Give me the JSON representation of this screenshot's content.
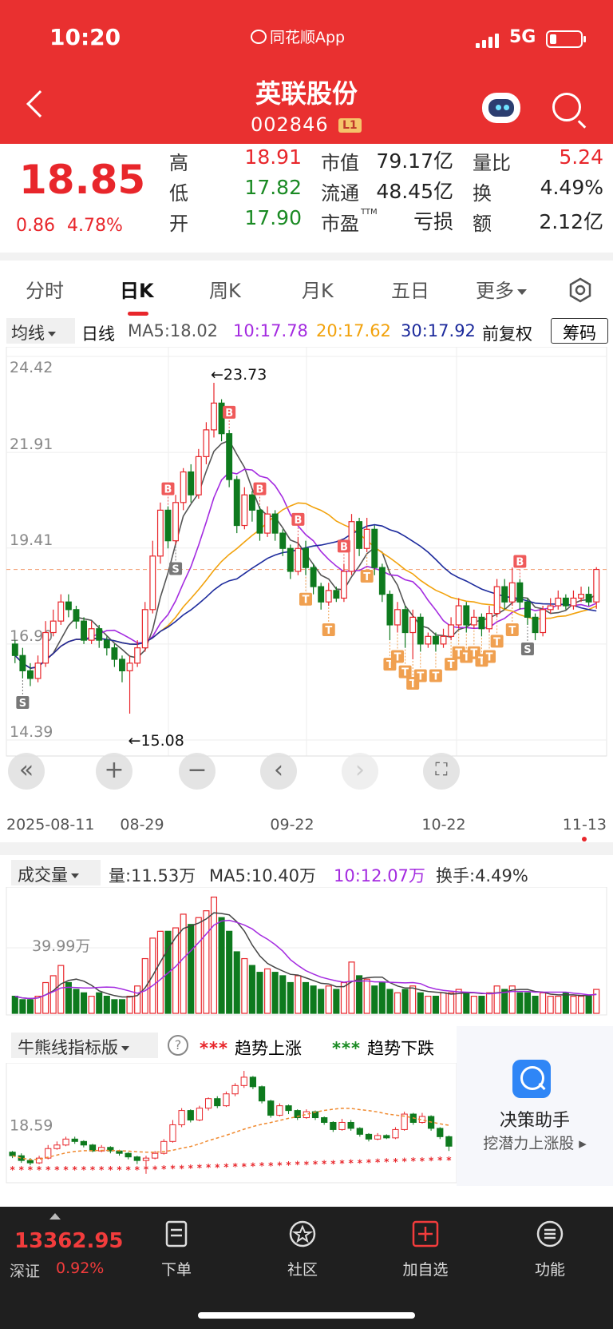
{
  "status": {
    "time": "10:20",
    "app": "同花顺App",
    "network": "5G"
  },
  "header": {
    "name": "英联股份",
    "code": "002846",
    "level": "L1"
  },
  "quote": {
    "price": "18.85",
    "change": "0.86",
    "change_pct": "4.78%",
    "high_label": "高",
    "high": "18.91",
    "low_label": "低",
    "low": "17.82",
    "open_label": "开",
    "open": "17.90",
    "mcap_label": "市值",
    "mcap": "79.17亿",
    "float_label": "流通",
    "float": "48.45亿",
    "pe_label": "市盈",
    "pe_sup": "TTM",
    "pe": "亏损",
    "vr_label": "量比",
    "vr": "5.24",
    "turn_label": "换",
    "turn": "4.49%",
    "amt_label": "额",
    "amt": "2.12亿"
  },
  "tabs": [
    {
      "label": "分时"
    },
    {
      "label": "日K"
    },
    {
      "label": "周K"
    },
    {
      "label": "月K"
    },
    {
      "label": "五日"
    },
    {
      "label": "更多"
    }
  ],
  "ma_bar": {
    "selector": "均线",
    "period": "日线",
    "ma5": "MA5:18.02",
    "ma10": "10:17.78",
    "ma20": "20:17.62",
    "ma30": "30:17.92",
    "adjust": "前复权",
    "chip": "筹码"
  },
  "colors": {
    "up": "#e8262b",
    "down": "#0e7a1e",
    "ma5": "#555555",
    "ma10": "#a42be0",
    "ma20": "#f2a20c",
    "ma30": "#1c2a9c",
    "signal": "#f0a050"
  },
  "chart_data": {
    "type": "candlestick",
    "y_ticks": [
      "24.42",
      "21.91",
      "19.41",
      "16.90",
      "14.39"
    ],
    "ylim": [
      14.39,
      24.42
    ],
    "x_ticks": [
      "2025-08-11",
      "08-29",
      "09-22",
      "10-22",
      "11-13"
    ],
    "high_annotation": "←23.73",
    "low_annotation": "←15.08",
    "last_close": 18.85,
    "candles": [
      [
        16.9,
        16.6,
        17.0,
        16.4
      ],
      [
        16.6,
        16.2,
        16.8,
        16.0
      ],
      [
        16.2,
        16.0,
        16.4,
        15.8
      ],
      [
        16.0,
        16.4,
        16.6,
        15.9
      ],
      [
        16.4,
        17.2,
        17.5,
        16.3
      ],
      [
        17.2,
        17.5,
        17.8,
        17.1
      ],
      [
        17.5,
        18.0,
        18.2,
        17.4
      ],
      [
        18.0,
        17.8,
        18.2,
        17.6
      ],
      [
        17.8,
        17.5,
        17.9,
        17.3
      ],
      [
        17.5,
        17.0,
        17.6,
        16.9
      ],
      [
        17.0,
        17.3,
        17.5,
        16.9
      ],
      [
        17.3,
        17.0,
        17.4,
        16.8
      ],
      [
        17.0,
        16.8,
        17.1,
        16.6
      ],
      [
        16.8,
        16.5,
        16.9,
        16.3
      ],
      [
        16.5,
        16.2,
        16.6,
        15.9
      ],
      [
        16.2,
        16.4,
        16.6,
        15.08
      ],
      [
        16.4,
        16.8,
        17.0,
        16.3
      ],
      [
        16.8,
        17.8,
        18.0,
        16.7
      ],
      [
        17.8,
        19.2,
        19.6,
        17.7
      ],
      [
        19.2,
        20.4,
        20.6,
        19.0
      ],
      [
        20.4,
        19.6,
        20.5,
        19.4
      ],
      [
        19.6,
        20.6,
        20.8,
        19.5
      ],
      [
        20.6,
        21.4,
        21.5,
        20.4
      ],
      [
        21.4,
        20.8,
        21.6,
        20.6
      ],
      [
        20.8,
        21.8,
        22.0,
        20.7
      ],
      [
        21.8,
        22.5,
        22.7,
        21.6
      ],
      [
        22.5,
        23.2,
        23.73,
        22.3
      ],
      [
        23.2,
        22.4,
        23.3,
        22.2
      ],
      [
        22.4,
        21.2,
        22.5,
        21.0
      ],
      [
        21.2,
        20.0,
        21.3,
        19.8
      ],
      [
        20.0,
        20.8,
        21.0,
        19.9
      ],
      [
        20.8,
        20.4,
        20.9,
        20.1
      ],
      [
        20.4,
        19.8,
        20.5,
        19.6
      ],
      [
        19.8,
        20.3,
        20.5,
        19.7
      ],
      [
        20.3,
        19.8,
        20.4,
        19.6
      ],
      [
        19.8,
        19.4,
        19.9,
        19.2
      ],
      [
        19.4,
        18.8,
        19.5,
        18.6
      ],
      [
        18.8,
        19.4,
        19.7,
        18.7
      ],
      [
        19.4,
        18.9,
        19.6,
        18.7
      ],
      [
        18.9,
        18.4,
        19.0,
        18.2
      ],
      [
        18.4,
        18.0,
        18.5,
        17.8
      ],
      [
        18.0,
        18.3,
        18.5,
        17.9
      ],
      [
        18.3,
        18.1,
        18.4,
        18.0
      ],
      [
        18.1,
        18.8,
        19.0,
        18.0
      ],
      [
        18.8,
        20.1,
        20.3,
        18.7
      ],
      [
        20.1,
        19.4,
        20.2,
        19.2
      ],
      [
        19.4,
        19.9,
        20.2,
        19.3
      ],
      [
        19.9,
        18.9,
        20.0,
        18.7
      ],
      [
        18.9,
        18.2,
        19.0,
        18.0
      ],
      [
        18.2,
        17.4,
        18.3,
        17.0
      ],
      [
        17.4,
        17.8,
        18.0,
        17.2
      ],
      [
        17.8,
        17.2,
        17.9,
        16.8
      ],
      [
        17.2,
        17.6,
        17.8,
        16.5
      ],
      [
        17.6,
        16.9,
        17.7,
        16.7
      ],
      [
        16.9,
        17.1,
        17.2,
        16.8
      ],
      [
        17.1,
        16.9,
        17.2,
        16.7
      ],
      [
        16.9,
        17.1,
        17.3,
        16.8
      ],
      [
        17.1,
        17.4,
        17.6,
        17.0
      ],
      [
        17.4,
        17.9,
        18.1,
        17.3
      ],
      [
        17.9,
        17.4,
        18.0,
        17.2
      ],
      [
        17.4,
        17.6,
        17.8,
        17.3
      ],
      [
        17.6,
        17.3,
        17.7,
        17.1
      ],
      [
        17.3,
        17.7,
        17.9,
        17.2
      ],
      [
        17.7,
        18.4,
        18.6,
        17.6
      ],
      [
        18.4,
        18.0,
        18.6,
        17.8
      ],
      [
        18.0,
        18.5,
        18.9,
        17.9
      ],
      [
        18.5,
        18.0,
        18.6,
        17.8
      ],
      [
        18.0,
        17.6,
        18.1,
        17.4
      ],
      [
        17.6,
        17.2,
        17.7,
        17.0
      ],
      [
        17.2,
        17.8,
        17.9,
        17.1
      ],
      [
        17.8,
        17.9,
        18.1,
        17.7
      ],
      [
        17.9,
        18.1,
        18.3,
        17.8
      ],
      [
        18.1,
        17.9,
        18.2,
        17.8
      ],
      [
        17.9,
        18.1,
        18.3,
        17.8
      ],
      [
        18.1,
        18.2,
        18.4,
        18.0
      ],
      [
        18.2,
        18.0,
        18.4,
        17.9
      ],
      [
        18.0,
        18.85,
        18.91,
        17.82
      ]
    ],
    "ma_series": [
      "MA5",
      "MA10",
      "MA20",
      "MA30"
    ],
    "signals": [
      {
        "index": 1,
        "label": "S"
      },
      {
        "index": 20,
        "label": "B"
      },
      {
        "index": 21,
        "label": "S"
      },
      {
        "index": 28,
        "label": "B"
      },
      {
        "index": 32,
        "label": "B"
      },
      {
        "index": 37,
        "label": "B"
      },
      {
        "index": 38,
        "label": "T"
      },
      {
        "index": 41,
        "label": "T"
      },
      {
        "index": 43,
        "label": "B"
      },
      {
        "index": 46,
        "label": "T"
      },
      {
        "index": 49,
        "label": "T"
      },
      {
        "index": 50,
        "label": "T"
      },
      {
        "index": 51,
        "label": "T"
      },
      {
        "index": 52,
        "label": "T"
      },
      {
        "index": 53,
        "label": "T"
      },
      {
        "index": 55,
        "label": "T"
      },
      {
        "index": 57,
        "label": "T"
      },
      {
        "index": 58,
        "label": "T"
      },
      {
        "index": 59,
        "label": "T"
      },
      {
        "index": 60,
        "label": "T"
      },
      {
        "index": 61,
        "label": "T"
      },
      {
        "index": 62,
        "label": "T"
      },
      {
        "index": 63,
        "label": "T"
      },
      {
        "index": 65,
        "label": "T"
      },
      {
        "index": 66,
        "label": "B"
      },
      {
        "index": 67,
        "label": "S"
      }
    ]
  },
  "volume": {
    "selector": "成交量",
    "vol": "量:11.53万",
    "ma5": "MA5:10.40万",
    "ma10": "10:12.07万",
    "turnover": "换手:4.49%",
    "y_tick": "39.99万",
    "values": [
      5,
      4,
      4,
      5,
      9,
      11,
      14,
      9,
      7,
      6,
      5,
      6,
      5,
      4,
      4,
      5,
      8,
      16,
      22,
      24,
      24,
      25,
      29,
      26,
      28,
      30,
      34,
      28,
      24,
      18,
      16,
      14,
      12,
      13,
      12,
      11,
      9,
      11,
      9,
      8,
      7,
      8,
      7,
      9,
      15,
      11,
      10,
      8,
      9,
      7,
      6,
      7,
      8,
      6,
      5,
      5,
      6,
      6,
      7,
      6,
      5,
      5,
      6,
      8,
      7,
      8,
      6,
      6,
      5,
      6,
      5,
      5,
      6,
      5,
      5,
      5,
      7
    ]
  },
  "bull": {
    "selector": "牛熊线指标版",
    "help": "?",
    "legend_up": "趋势上涨",
    "legend_down": "趋势下跌",
    "y_tick": "18.59"
  },
  "helper": {
    "title": "决策助手",
    "subtitle": "挖潜力上涨股"
  },
  "bottom": {
    "index_value": "13362.95",
    "index_name": "深证",
    "index_pct": "0.92%",
    "nav": [
      {
        "label": "下单"
      },
      {
        "label": "社区"
      },
      {
        "label": "加自选"
      },
      {
        "label": "功能"
      }
    ]
  }
}
